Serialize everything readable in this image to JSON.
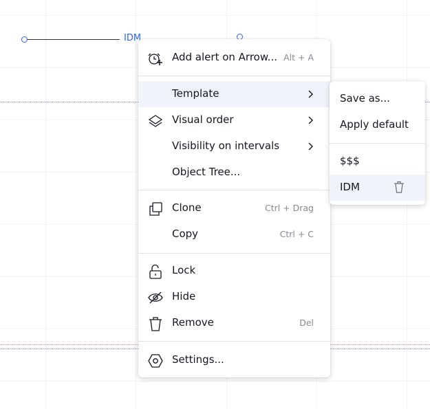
{
  "chart": {
    "drawing_label": "IDM"
  },
  "context_menu": {
    "items": [
      {
        "label": "Add alert on Arrow...",
        "hint": "Alt + A",
        "icon": "alarm-plus-icon"
      },
      {
        "label": "Template",
        "icon": "",
        "submenu": true,
        "active": true
      },
      {
        "label": "Visual order",
        "icon": "layers-icon",
        "submenu": true
      },
      {
        "label": "Visibility on intervals",
        "icon": "",
        "submenu": true
      },
      {
        "label": "Object Tree...",
        "icon": ""
      },
      {
        "label": "Clone",
        "hint": "Ctrl + Drag",
        "icon": "clone-icon"
      },
      {
        "label": "Copy",
        "hint": "Ctrl + C",
        "icon": ""
      },
      {
        "label": "Lock",
        "icon": "unlock-icon"
      },
      {
        "label": "Hide",
        "icon": "eye-off-icon"
      },
      {
        "label": "Remove",
        "hint": "Del",
        "icon": "trash-icon"
      },
      {
        "label": "Settings...",
        "icon": "settings-hexagon-icon"
      }
    ]
  },
  "template_submenu": {
    "items": [
      {
        "label": "Save as..."
      },
      {
        "label": "Apply default"
      },
      {
        "label": "$$$"
      },
      {
        "label": "IDM",
        "active": true,
        "icon": "trash-icon"
      }
    ]
  },
  "colors": {
    "accent": "#2962ff",
    "hover_bg": "#f0f3fa",
    "text": "#131722",
    "hint": "#868993"
  }
}
